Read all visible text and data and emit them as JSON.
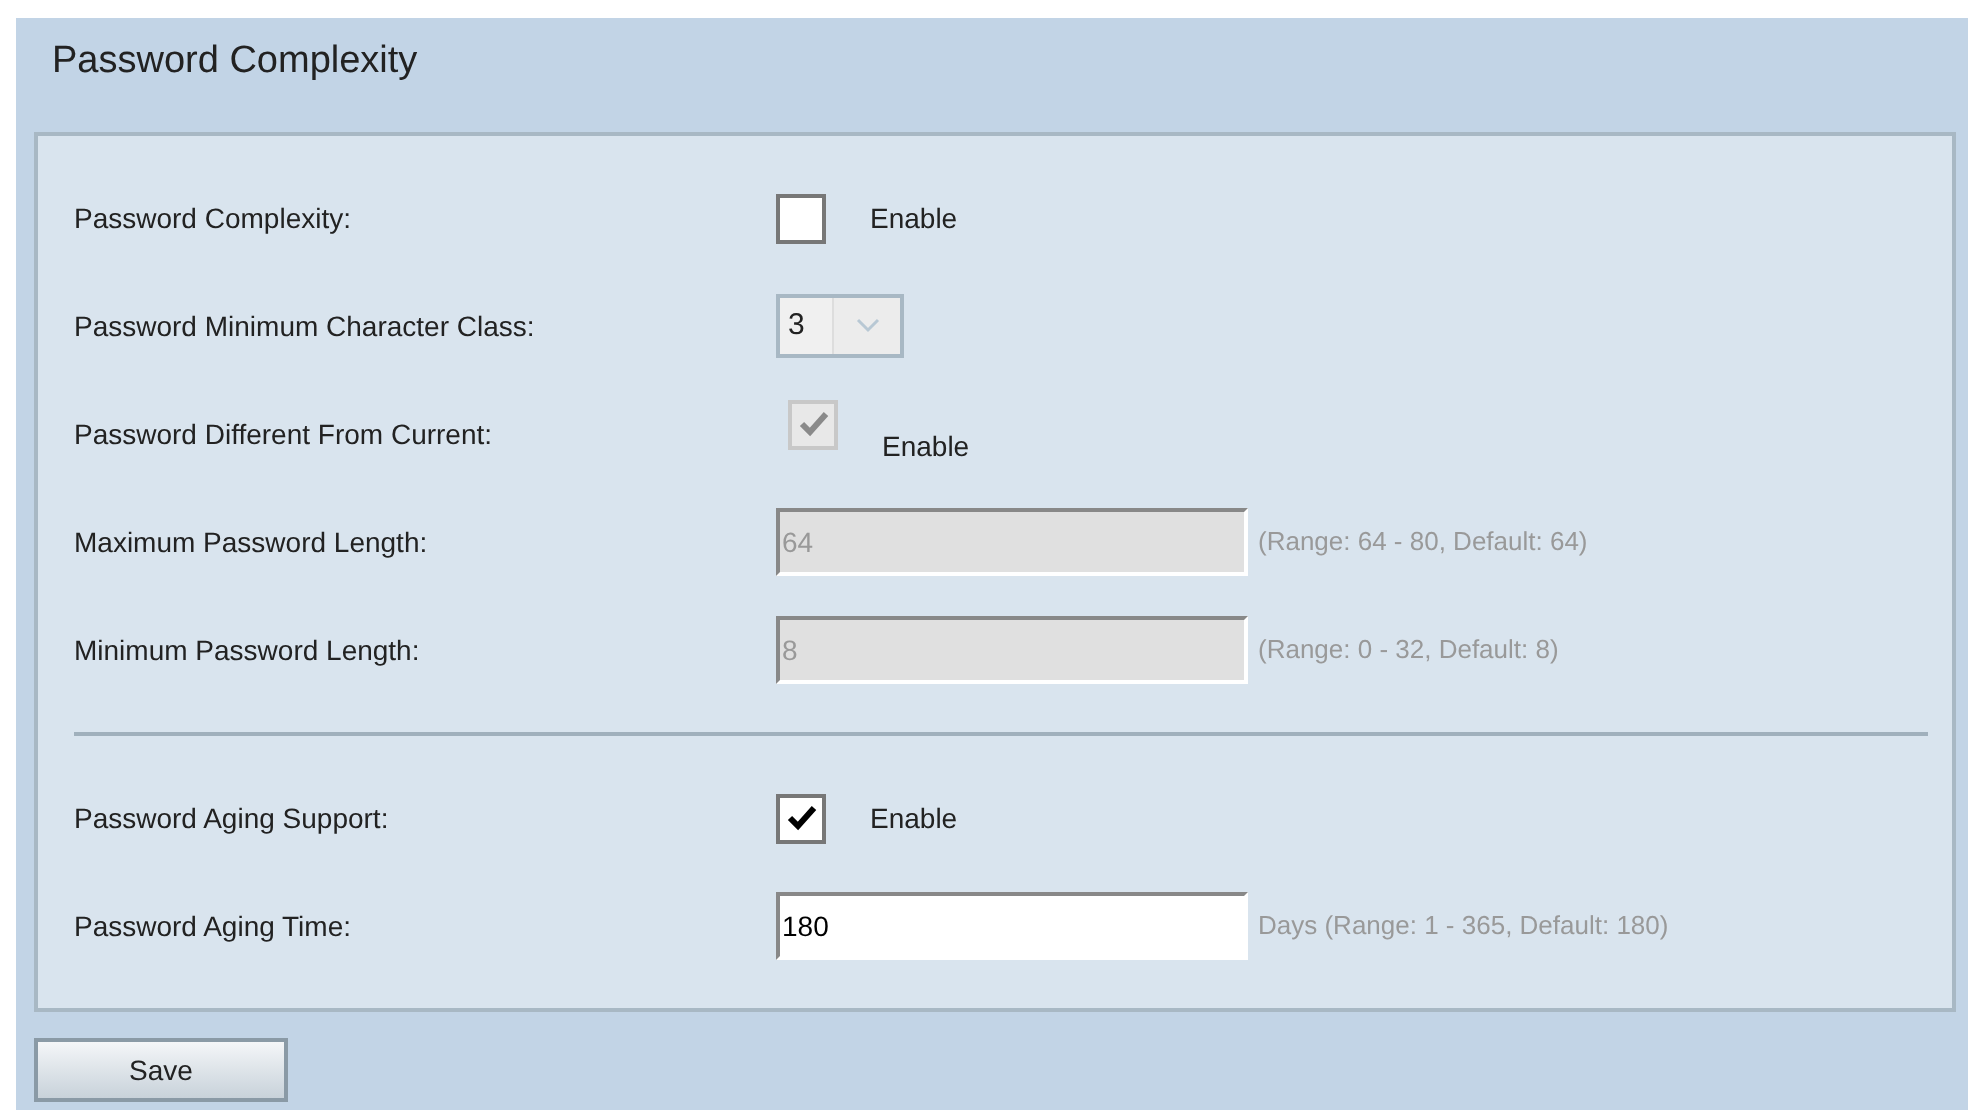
{
  "title": "Password Complexity",
  "sections": [
    {
      "rows": [
        {
          "kind": "checkbox",
          "label": "Password Complexity:",
          "checked": false,
          "disabled": false,
          "text": "Enable"
        },
        {
          "kind": "select",
          "label": "Password Minimum Character Class:",
          "value": "3",
          "disabled": true
        },
        {
          "kind": "checkbox",
          "label": "Password Different From Current:",
          "checked": true,
          "disabled": true,
          "text": "Enable"
        },
        {
          "kind": "text",
          "label": "Maximum Password Length:",
          "value": "64",
          "disabled": true,
          "hint": "(Range: 64 - 80, Default: 64)"
        },
        {
          "kind": "text",
          "label": "Minimum Password Length:",
          "value": "8",
          "disabled": true,
          "hint": "(Range: 0 - 32, Default: 8)"
        }
      ]
    },
    {
      "rows": [
        {
          "kind": "checkbox",
          "label": "Password Aging Support:",
          "checked": true,
          "disabled": false,
          "text": "Enable"
        },
        {
          "kind": "text",
          "label": "Password Aging Time:",
          "value": "180",
          "disabled": false,
          "hint": "Days (Range: 1 - 365, Default: 180)"
        }
      ]
    }
  ],
  "save_button": "Save"
}
